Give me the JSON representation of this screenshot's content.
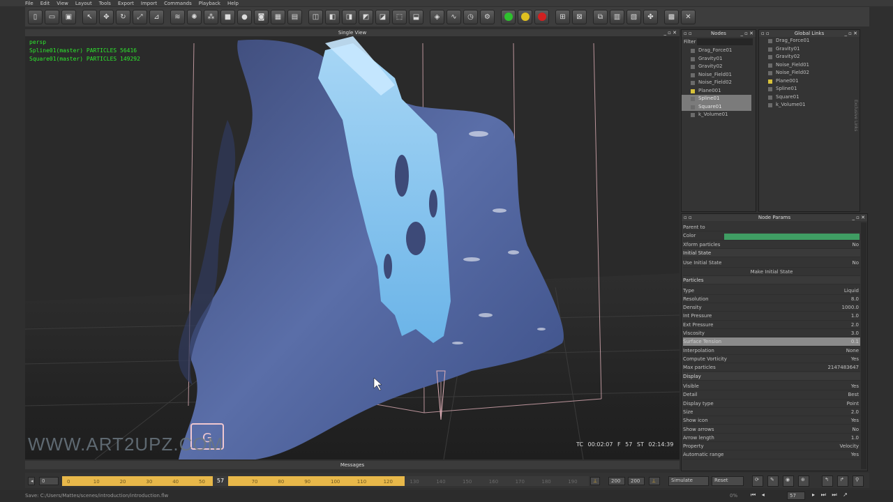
{
  "menu": [
    "File",
    "Edit",
    "View",
    "Layout",
    "Tools",
    "Export",
    "Import",
    "Commands",
    "Playback",
    "Help"
  ],
  "viewport": {
    "title": "Single View",
    "camera": "persp",
    "overlay_lines": [
      "Spline01(master) PARTICLES 56416",
      "Square01(master) PARTICLES 149292"
    ],
    "timecode": "TC 00:02:07   F 57   ST 02:14:39",
    "watermark": "WWW.ART2UPZ.COM"
  },
  "nodes_panel": {
    "title": "Nodes",
    "filter_label": "Filter",
    "items": [
      "Drag_Force01",
      "Gravity01",
      "Gravity02",
      "Noise_Field01",
      "Noise_Field02",
      "Plane001",
      "Spline01",
      "Square01",
      "k_Volume01"
    ]
  },
  "links_panel": {
    "title": "Global Links",
    "items": [
      "Drag_Force01",
      "Gravity01",
      "Gravity02",
      "Noise_Field01",
      "Noise_Field02",
      "Plane001",
      "Spline01",
      "Square01",
      "k_Volume01"
    ],
    "side_label": "Exclusive Links"
  },
  "node_params": {
    "title": "Node Params",
    "rows": [
      {
        "k": "Parent to",
        "v": ""
      },
      {
        "k": "Color",
        "v": ""
      },
      {
        "k": "Xform particles",
        "v": "No"
      },
      {
        "k": "Initial State",
        "v": "",
        "section": true
      },
      {
        "k": "Use Initial State",
        "v": "No"
      },
      {
        "k": "Make Initial State",
        "v": "",
        "button": true
      },
      {
        "k": "Particles",
        "v": "",
        "section": true
      },
      {
        "k": "Type",
        "v": "Liquid"
      },
      {
        "k": "Resolution",
        "v": "8.0"
      },
      {
        "k": "Density",
        "v": "1000.0"
      },
      {
        "k": "Int Pressure",
        "v": "1.0"
      },
      {
        "k": "Ext Pressure",
        "v": "2.0"
      },
      {
        "k": "Viscosity",
        "v": "3.0"
      },
      {
        "k": "Surface Tension",
        "v": "0.1",
        "hl": true
      },
      {
        "k": "Interpolation",
        "v": "None"
      },
      {
        "k": "Compute Vorticity",
        "v": "Yes"
      },
      {
        "k": "Max particles",
        "v": "2147483647"
      },
      {
        "k": "Display",
        "v": "",
        "section": true
      },
      {
        "k": "Visible",
        "v": "Yes"
      },
      {
        "k": "Detail",
        "v": "Best"
      },
      {
        "k": "Display type",
        "v": "Point"
      },
      {
        "k": "Size",
        "v": "2.0"
      },
      {
        "k": "Show icon",
        "v": "Yes"
      },
      {
        "k": "Show arrows",
        "v": "No"
      },
      {
        "k": "Arrow length",
        "v": "1.0"
      },
      {
        "k": "Property",
        "v": "Velocity"
      },
      {
        "k": "Automatic range",
        "v": "Yes"
      }
    ],
    "color_value": "#3f9d63"
  },
  "messages": {
    "title": "Messages"
  },
  "timeline": {
    "start": "0",
    "ticks": [
      "0",
      "10",
      "20",
      "30",
      "40",
      "50",
      "70",
      "80",
      "90",
      "100",
      "110",
      "120",
      "130",
      "140",
      "150",
      "160",
      "170",
      "180",
      "190"
    ],
    "current_frame": "57",
    "end_a": "200",
    "end_b": "200",
    "simulate_label": "Simulate",
    "reset_label": "Reset"
  },
  "status": {
    "text": "Save: C:/Users/Mattes/scenes/introduction/introduction.flw",
    "progress": "0%",
    "frame_box": "57"
  }
}
